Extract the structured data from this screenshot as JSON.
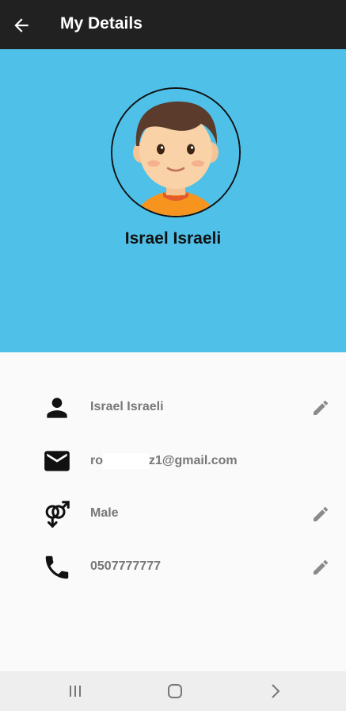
{
  "appbar": {
    "title": "My Details",
    "back_icon": "arrow-left-icon"
  },
  "profile": {
    "name": "Israel Israeli",
    "avatar_icon": "boy-avatar"
  },
  "details": [
    {
      "icon": "person-icon",
      "value": "Israel Israeli",
      "editable": true
    },
    {
      "icon": "email-icon",
      "value_prefix": "ro",
      "value_suffix": "z1@gmail.com",
      "editable": false
    },
    {
      "icon": "gender-icon",
      "value": "Male",
      "editable": true
    },
    {
      "icon": "phone-icon",
      "value": "0507777777",
      "editable": true
    }
  ],
  "navbar": {
    "items": [
      "recent-apps-icon",
      "home-icon",
      "back-icon"
    ]
  },
  "colors": {
    "header_bg": "#4fc1e9",
    "appbar_bg": "#212121",
    "text_muted": "#777777"
  }
}
